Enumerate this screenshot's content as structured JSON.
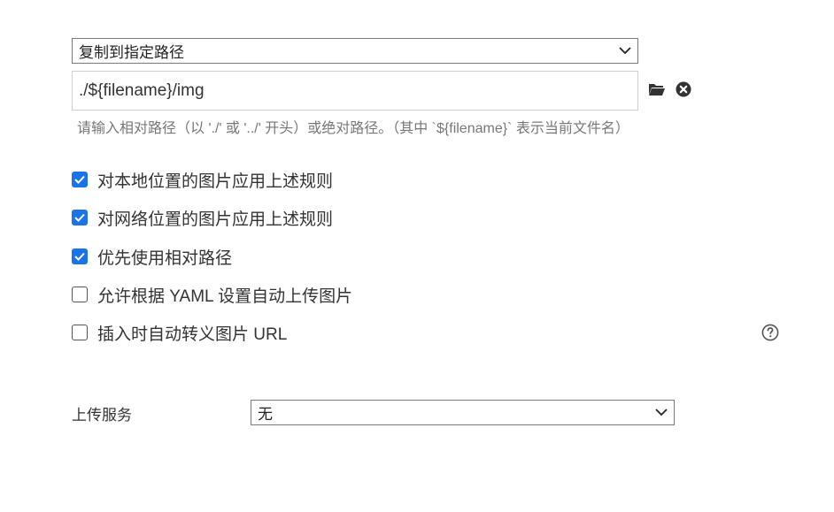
{
  "image_path": {
    "mode_select": {
      "selected": "复制到指定路径"
    },
    "path_input": {
      "value": "./${filename}/img"
    },
    "hint": "请输入相对路径（以 './' 或 '../' 开头）或绝对路径。（其中 `${filename}` 表示当前文件名）",
    "icons": {
      "folder": "folder-icon",
      "clear": "close-circle-icon",
      "help": "help-circle-icon"
    }
  },
  "options": [
    {
      "label": "对本地位置的图片应用上述规则",
      "checked": true
    },
    {
      "label": "对网络位置的图片应用上述规则",
      "checked": true
    },
    {
      "label": "优先使用相对路径",
      "checked": true
    },
    {
      "label": "允许根据 YAML 设置自动上传图片",
      "checked": false
    },
    {
      "label": "插入时自动转义图片 URL",
      "checked": false
    }
  ],
  "upload_service": {
    "label": "上传服务",
    "selected": "无"
  },
  "colors": {
    "checkbox_checked": "#1a73e8",
    "text": "#333333",
    "hint_text": "#777777"
  }
}
